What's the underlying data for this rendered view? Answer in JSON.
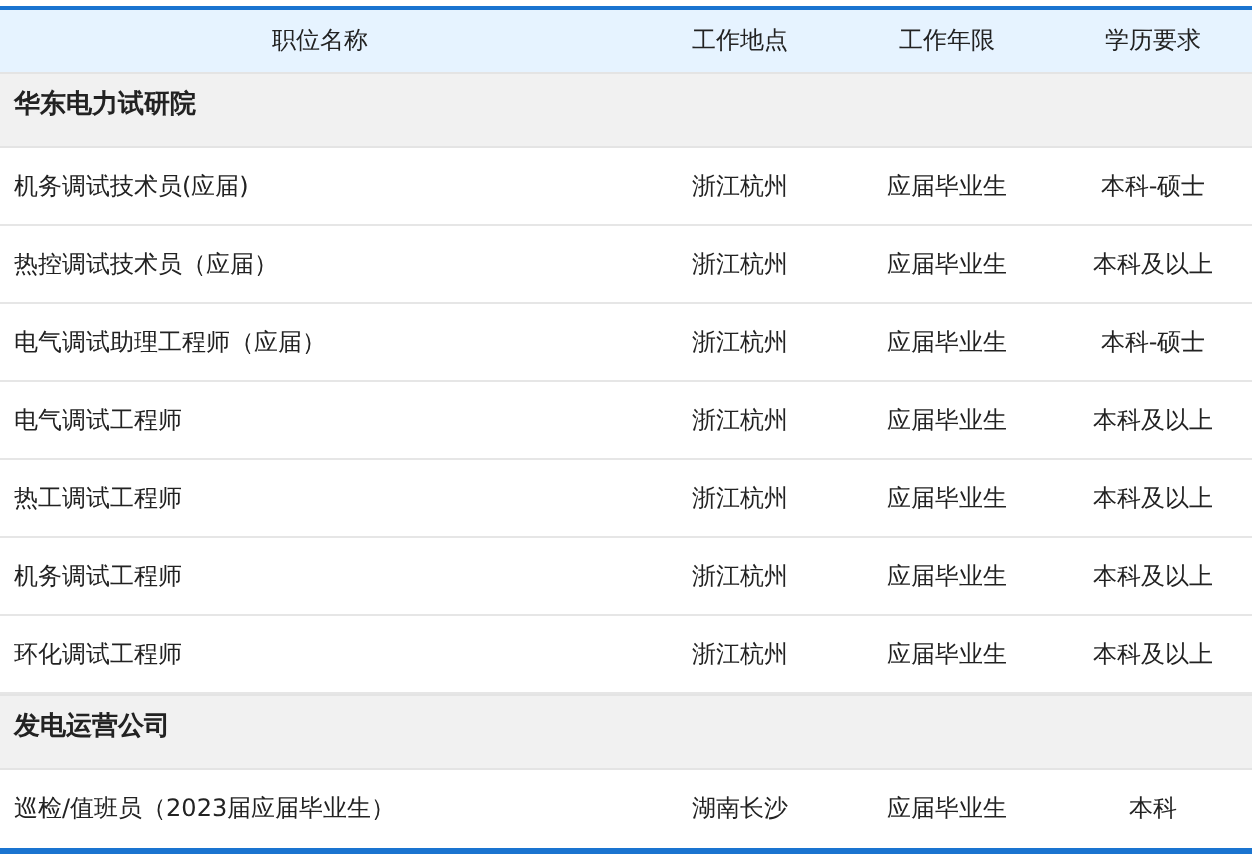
{
  "table": {
    "columns": [
      "职位名称",
      "工作地点",
      "工作年限",
      "学历要求"
    ],
    "groups": [
      {
        "name": "华东电力试研院",
        "rows": [
          [
            "机务调试技术员(应届)",
            "浙江杭州",
            "应届毕业生",
            "本科-硕士"
          ],
          [
            "热控调试技术员（应届）",
            "浙江杭州",
            "应届毕业生",
            "本科及以上"
          ],
          [
            "电气调试助理工程师（应届）",
            "浙江杭州",
            "应届毕业生",
            "本科-硕士"
          ],
          [
            "电气调试工程师",
            "浙江杭州",
            "应届毕业生",
            "本科及以上"
          ],
          [
            "热工调试工程师",
            "浙江杭州",
            "应届毕业生",
            "本科及以上"
          ],
          [
            "机务调试工程师",
            "浙江杭州",
            "应届毕业生",
            "本科及以上"
          ],
          [
            "环化调试工程师",
            "浙江杭州",
            "应届毕业生",
            "本科及以上"
          ]
        ]
      },
      {
        "name": "发电运营公司",
        "rows": [
          [
            "巡检/值班员（2023届应届毕业生）",
            "湖南长沙",
            "应届毕业生",
            "本科"
          ]
        ]
      }
    ]
  }
}
